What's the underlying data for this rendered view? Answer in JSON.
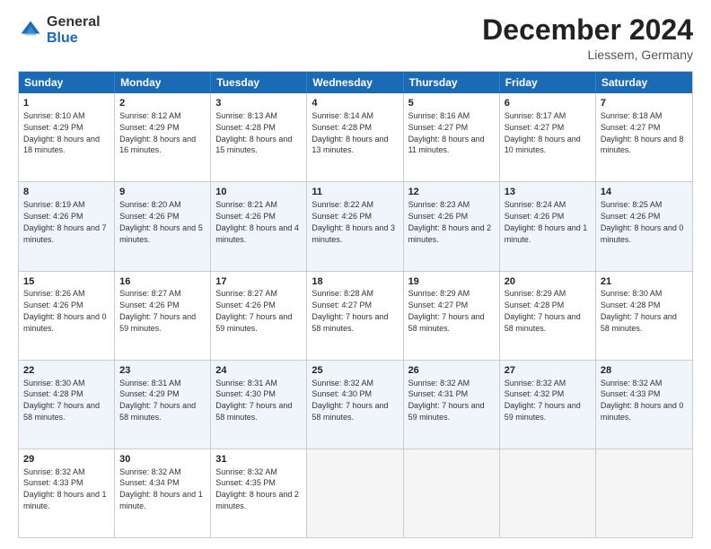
{
  "logo": {
    "general": "General",
    "blue": "Blue"
  },
  "title": "December 2024",
  "location": "Liessem, Germany",
  "days": [
    "Sunday",
    "Monday",
    "Tuesday",
    "Wednesday",
    "Thursday",
    "Friday",
    "Saturday"
  ],
  "rows": [
    [
      {
        "day": "1",
        "sunrise": "8:10 AM",
        "sunset": "4:29 PM",
        "daylight": "8 hours and 18 minutes."
      },
      {
        "day": "2",
        "sunrise": "8:12 AM",
        "sunset": "4:29 PM",
        "daylight": "8 hours and 16 minutes."
      },
      {
        "day": "3",
        "sunrise": "8:13 AM",
        "sunset": "4:28 PM",
        "daylight": "8 hours and 15 minutes."
      },
      {
        "day": "4",
        "sunrise": "8:14 AM",
        "sunset": "4:28 PM",
        "daylight": "8 hours and 13 minutes."
      },
      {
        "day": "5",
        "sunrise": "8:16 AM",
        "sunset": "4:27 PM",
        "daylight": "8 hours and 11 minutes."
      },
      {
        "day": "6",
        "sunrise": "8:17 AM",
        "sunset": "4:27 PM",
        "daylight": "8 hours and 10 minutes."
      },
      {
        "day": "7",
        "sunrise": "8:18 AM",
        "sunset": "4:27 PM",
        "daylight": "8 hours and 8 minutes."
      }
    ],
    [
      {
        "day": "8",
        "sunrise": "8:19 AM",
        "sunset": "4:26 PM",
        "daylight": "8 hours and 7 minutes."
      },
      {
        "day": "9",
        "sunrise": "8:20 AM",
        "sunset": "4:26 PM",
        "daylight": "8 hours and 5 minutes."
      },
      {
        "day": "10",
        "sunrise": "8:21 AM",
        "sunset": "4:26 PM",
        "daylight": "8 hours and 4 minutes."
      },
      {
        "day": "11",
        "sunrise": "8:22 AM",
        "sunset": "4:26 PM",
        "daylight": "8 hours and 3 minutes."
      },
      {
        "day": "12",
        "sunrise": "8:23 AM",
        "sunset": "4:26 PM",
        "daylight": "8 hours and 2 minutes."
      },
      {
        "day": "13",
        "sunrise": "8:24 AM",
        "sunset": "4:26 PM",
        "daylight": "8 hours and 1 minute."
      },
      {
        "day": "14",
        "sunrise": "8:25 AM",
        "sunset": "4:26 PM",
        "daylight": "8 hours and 0 minutes."
      }
    ],
    [
      {
        "day": "15",
        "sunrise": "8:26 AM",
        "sunset": "4:26 PM",
        "daylight": "8 hours and 0 minutes."
      },
      {
        "day": "16",
        "sunrise": "8:27 AM",
        "sunset": "4:26 PM",
        "daylight": "7 hours and 59 minutes."
      },
      {
        "day": "17",
        "sunrise": "8:27 AM",
        "sunset": "4:26 PM",
        "daylight": "7 hours and 59 minutes."
      },
      {
        "day": "18",
        "sunrise": "8:28 AM",
        "sunset": "4:27 PM",
        "daylight": "7 hours and 58 minutes."
      },
      {
        "day": "19",
        "sunrise": "8:29 AM",
        "sunset": "4:27 PM",
        "daylight": "7 hours and 58 minutes."
      },
      {
        "day": "20",
        "sunrise": "8:29 AM",
        "sunset": "4:28 PM",
        "daylight": "7 hours and 58 minutes."
      },
      {
        "day": "21",
        "sunrise": "8:30 AM",
        "sunset": "4:28 PM",
        "daylight": "7 hours and 58 minutes."
      }
    ],
    [
      {
        "day": "22",
        "sunrise": "8:30 AM",
        "sunset": "4:28 PM",
        "daylight": "7 hours and 58 minutes."
      },
      {
        "day": "23",
        "sunrise": "8:31 AM",
        "sunset": "4:29 PM",
        "daylight": "7 hours and 58 minutes."
      },
      {
        "day": "24",
        "sunrise": "8:31 AM",
        "sunset": "4:30 PM",
        "daylight": "7 hours and 58 minutes."
      },
      {
        "day": "25",
        "sunrise": "8:32 AM",
        "sunset": "4:30 PM",
        "daylight": "7 hours and 58 minutes."
      },
      {
        "day": "26",
        "sunrise": "8:32 AM",
        "sunset": "4:31 PM",
        "daylight": "7 hours and 59 minutes."
      },
      {
        "day": "27",
        "sunrise": "8:32 AM",
        "sunset": "4:32 PM",
        "daylight": "7 hours and 59 minutes."
      },
      {
        "day": "28",
        "sunrise": "8:32 AM",
        "sunset": "4:33 PM",
        "daylight": "8 hours and 0 minutes."
      }
    ],
    [
      {
        "day": "29",
        "sunrise": "8:32 AM",
        "sunset": "4:33 PM",
        "daylight": "8 hours and 1 minute."
      },
      {
        "day": "30",
        "sunrise": "8:32 AM",
        "sunset": "4:34 PM",
        "daylight": "8 hours and 1 minute."
      },
      {
        "day": "31",
        "sunrise": "8:32 AM",
        "sunset": "4:35 PM",
        "daylight": "8 hours and 2 minutes."
      },
      null,
      null,
      null,
      null
    ]
  ],
  "labels": {
    "sunrise": "Sunrise:",
    "sunset": "Sunset:",
    "daylight": "Daylight:"
  }
}
